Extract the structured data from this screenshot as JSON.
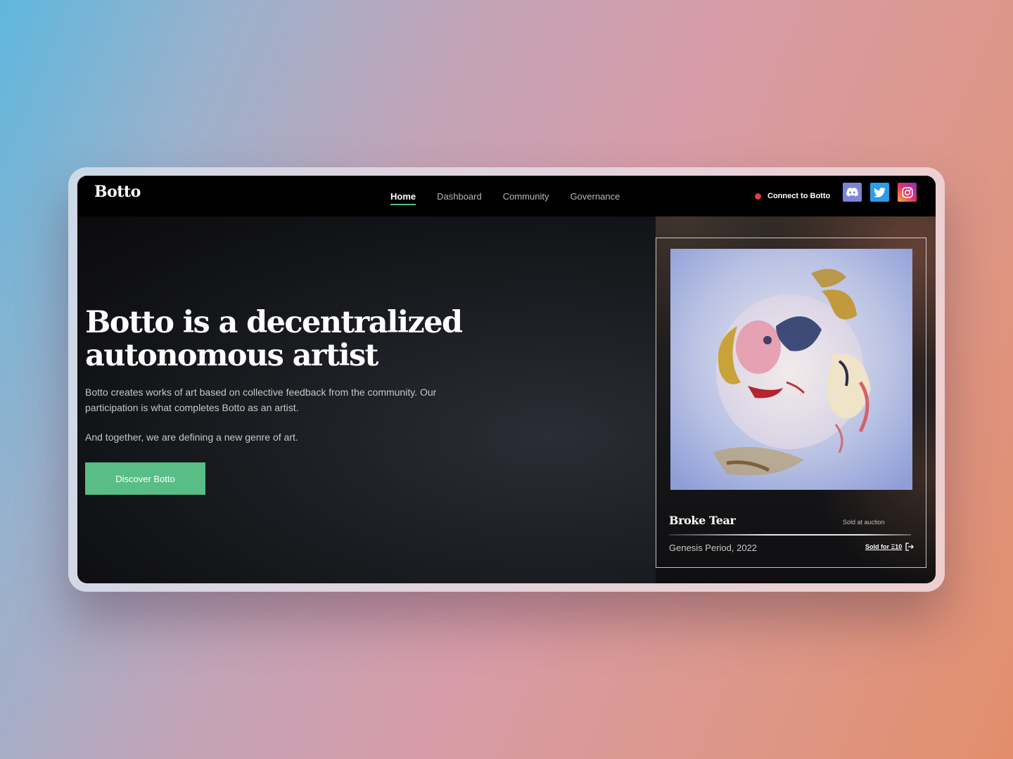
{
  "nav": {
    "logo": "Botto",
    "items": [
      {
        "label": "Home",
        "active": true
      },
      {
        "label": "Dashboard",
        "active": false
      },
      {
        "label": "Community",
        "active": false
      },
      {
        "label": "Governance",
        "active": false
      }
    ],
    "connect_label": "Connect to Botto",
    "status_color": "#e23b47",
    "social": [
      "discord-icon",
      "twitter-icon",
      "instagram-icon"
    ]
  },
  "hero": {
    "headline_line1": "Botto is a decentralized",
    "headline_line2": "autonomous artist",
    "description": "Botto creates works of art based on collective feedback from the community. Our participation is what completes Botto as an artist.",
    "tagline": "And together, we are defining a new genre of art.",
    "cta_label": "Discover Botto",
    "accent_color": "#58be86"
  },
  "artwork": {
    "title": "Broke Tear",
    "status": "Sold at auction",
    "period": "Genesis Period, 2022",
    "sold_for": "Sold for Ξ10"
  }
}
